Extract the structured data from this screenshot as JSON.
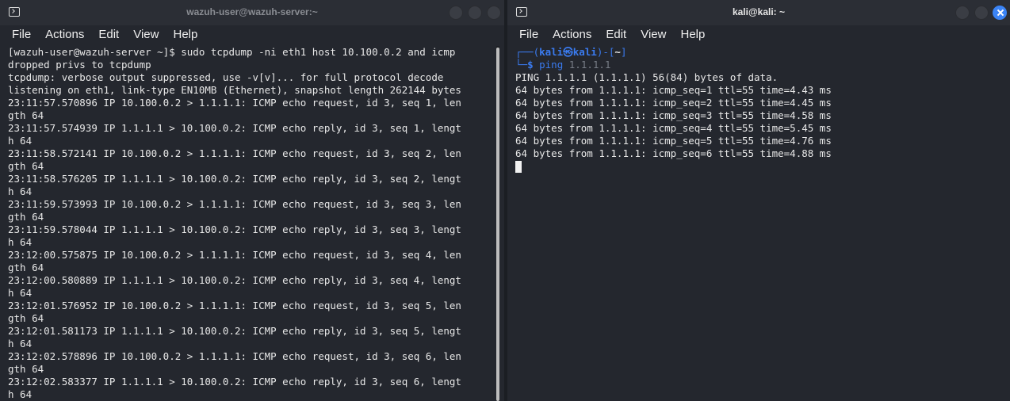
{
  "left_window": {
    "title": "wazuh-user@wazuh-server:~",
    "menu": [
      "File",
      "Actions",
      "Edit",
      "View",
      "Help"
    ],
    "lines": [
      "[wazuh-user@wazuh-server ~]$ sudo tcpdump -ni eth1 host 10.100.0.2 and icmp",
      "dropped privs to tcpdump",
      "tcpdump: verbose output suppressed, use -v[v]... for full protocol decode",
      "listening on eth1, link-type EN10MB (Ethernet), snapshot length 262144 bytes",
      "23:11:57.570896 IP 10.100.0.2 > 1.1.1.1: ICMP echo request, id 3, seq 1, len",
      "gth 64",
      "23:11:57.574939 IP 1.1.1.1 > 10.100.0.2: ICMP echo reply, id 3, seq 1, lengt",
      "h 64",
      "23:11:58.572141 IP 10.100.0.2 > 1.1.1.1: ICMP echo request, id 3, seq 2, len",
      "gth 64",
      "23:11:58.576205 IP 1.1.1.1 > 10.100.0.2: ICMP echo reply, id 3, seq 2, lengt",
      "h 64",
      "23:11:59.573993 IP 10.100.0.2 > 1.1.1.1: ICMP echo request, id 3, seq 3, len",
      "gth 64",
      "23:11:59.578044 IP 1.1.1.1 > 10.100.0.2: ICMP echo reply, id 3, seq 3, lengt",
      "h 64",
      "23:12:00.575875 IP 10.100.0.2 > 1.1.1.1: ICMP echo request, id 3, seq 4, len",
      "gth 64",
      "23:12:00.580889 IP 1.1.1.1 > 10.100.0.2: ICMP echo reply, id 3, seq 4, lengt",
      "h 64",
      "23:12:01.576952 IP 10.100.0.2 > 1.1.1.1: ICMP echo request, id 3, seq 5, len",
      "gth 64",
      "23:12:01.581173 IP 1.1.1.1 > 10.100.0.2: ICMP echo reply, id 3, seq 5, lengt",
      "h 64",
      "23:12:02.578896 IP 10.100.0.2 > 1.1.1.1: ICMP echo request, id 3, seq 6, len",
      "gth 64",
      "23:12:02.583377 IP 1.1.1.1 > 10.100.0.2: ICMP echo reply, id 3, seq 6, lengt",
      "h 64"
    ]
  },
  "right_window": {
    "title": "kali@kali: ~",
    "menu": [
      "File",
      "Actions",
      "Edit",
      "View",
      "Help"
    ],
    "prompt": {
      "open": "┌──(",
      "user": "kali㉿kali",
      "mid": ")-[",
      "path": "~",
      "close": "]",
      "bottom": "└─",
      "dollar": "$",
      "command": "ping",
      "argument": "1.1.1.1"
    },
    "lines": [
      "PING 1.1.1.1 (1.1.1.1) 56(84) bytes of data.",
      "64 bytes from 1.1.1.1: icmp_seq=1 ttl=55 time=4.43 ms",
      "64 bytes from 1.1.1.1: icmp_seq=2 ttl=55 time=4.45 ms",
      "64 bytes from 1.1.1.1: icmp_seq=3 ttl=55 time=4.58 ms",
      "64 bytes from 1.1.1.1: icmp_seq=4 ttl=55 time=5.45 ms",
      "64 bytes from 1.1.1.1: icmp_seq=5 ttl=55 time=4.76 ms",
      "64 bytes from 1.1.1.1: icmp_seq=6 ttl=55 time=4.88 ms"
    ]
  },
  "colors": {
    "window_bg": "#24272e",
    "titlebar_bg": "#2b2e35",
    "kali_blue": "#3a7bf0",
    "close_active": "#3b84f6"
  },
  "icons": {
    "terminal": "terminal-icon",
    "minimize": "minimize-icon",
    "maximize": "maximize-icon",
    "close": "close-icon"
  }
}
